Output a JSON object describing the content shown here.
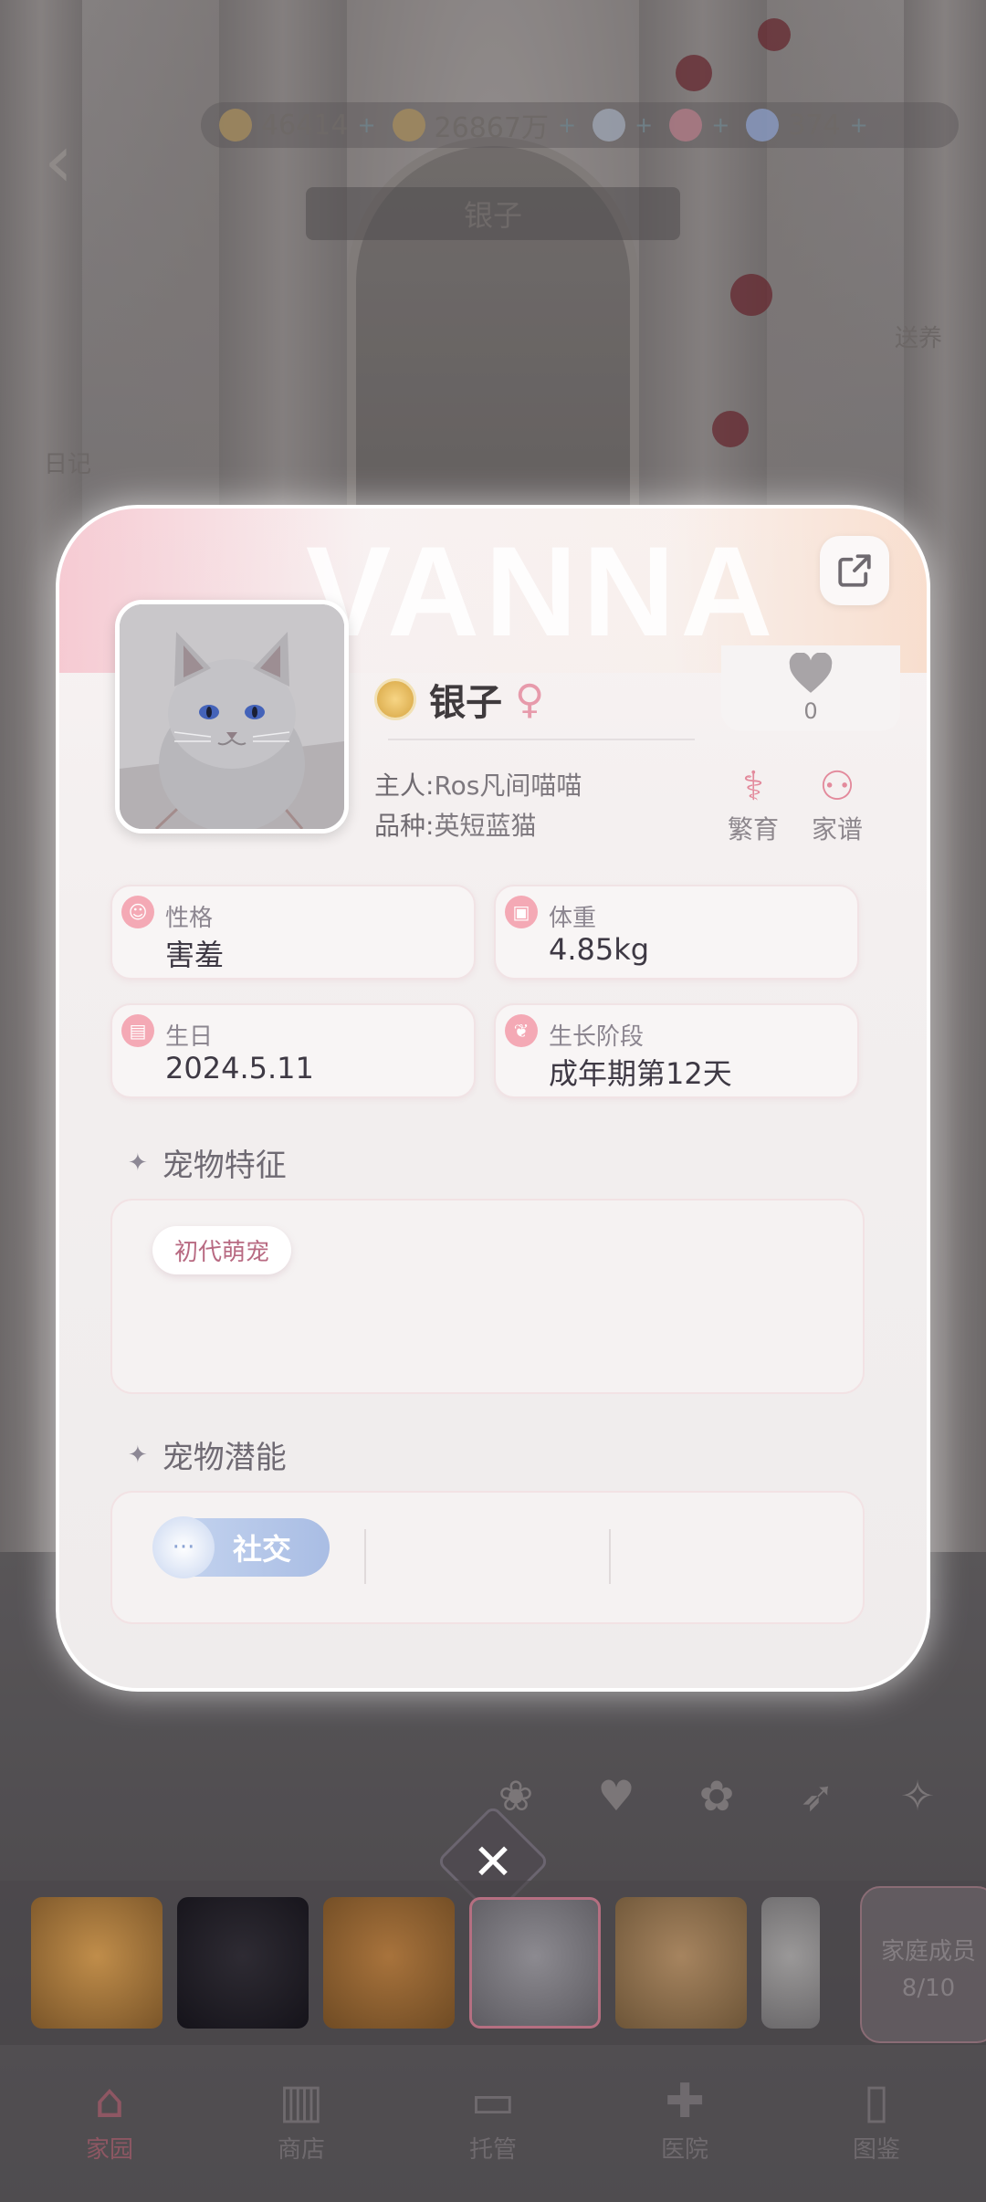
{
  "hud": {
    "items": [
      {
        "icon": "coin-icon",
        "value": "46414"
      },
      {
        "icon": "gold-icon",
        "value": "26867万"
      },
      {
        "icon": "gem-icon",
        "value": ""
      },
      {
        "icon": "heart-currency-icon",
        "value": ""
      },
      {
        "icon": "diamond-icon",
        "value": "374"
      }
    ],
    "location_name": "银子",
    "side_labels": [
      "日记",
      "送养"
    ]
  },
  "card": {
    "watermark": "VANNA",
    "pet": {
      "name": "银子",
      "gender_symbol": "♀",
      "owner_label": "主人:",
      "owner": "Ros凡间喵喵",
      "breed_label": "品种:",
      "breed": "英短蓝猫",
      "likes": "0"
    },
    "actions": [
      {
        "icon": "dna-icon",
        "label": "繁育"
      },
      {
        "icon": "family-tree-icon",
        "label": "家谱"
      }
    ],
    "stats": {
      "personality": {
        "label": "性格",
        "value": "害羞"
      },
      "weight": {
        "label": "体重",
        "value": "4.85kg"
      },
      "birthday": {
        "label": "生日",
        "value": "2024.5.11"
      },
      "stage": {
        "label": "生长阶段",
        "value": "成年期第12天"
      }
    },
    "traits_title": "宠物特征",
    "traits": [
      "初代萌宠"
    ],
    "potential_title": "宠物潜能",
    "potential": [
      "社交"
    ]
  },
  "pet_strip": {
    "family_label": "家庭成员",
    "family_count": "8/10"
  },
  "nav": [
    {
      "icon": "home-icon",
      "label": "家园",
      "active": true
    },
    {
      "icon": "shop-icon",
      "label": "商店"
    },
    {
      "icon": "briefcase-icon",
      "label": "托管"
    },
    {
      "icon": "hospital-icon",
      "label": "医院"
    },
    {
      "icon": "book-icon",
      "label": "图鉴"
    }
  ],
  "colors": {
    "accent_pink": "#e38a9c",
    "text_dark": "#3e3944",
    "card_bg": "#f3efef"
  }
}
